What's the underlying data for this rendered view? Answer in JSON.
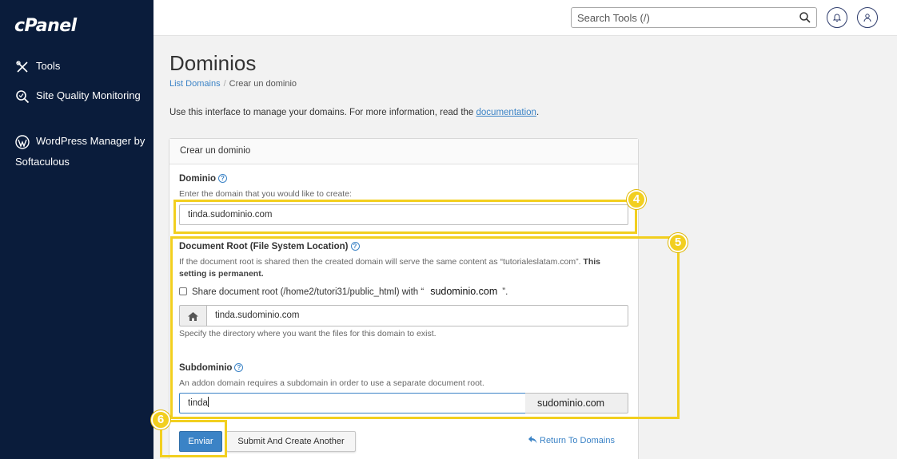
{
  "sidebar": {
    "logo": "cPanel",
    "items": [
      {
        "label": "Tools",
        "icon": "tools-icon"
      },
      {
        "label": "Site Quality Monitoring",
        "icon": "search-quality-icon"
      },
      {
        "label": "WordPress Manager by Softaculous",
        "icon": "wordpress-icon"
      }
    ]
  },
  "topbar": {
    "search_placeholder": "Search Tools (/)"
  },
  "page": {
    "title": "Dominios",
    "breadcrumb_link": "List Domains",
    "breadcrumb_current": "Crear un dominio",
    "intro_text": "Use this interface to manage your domains. For more information, read the ",
    "intro_link": "documentation",
    "intro_end": "."
  },
  "form": {
    "panel_title": "Crear un dominio",
    "domain_label": "Dominio",
    "domain_hint": "Enter the domain that you would like to create:",
    "domain_value": "tinda.sudominio.com",
    "docroot_label": "Document Root (File System Location)",
    "docroot_hint": "If the document root is shared then the created domain will serve the same content as “tutorialeslatam.com”.",
    "docroot_hint_bold": "This setting is permanent.",
    "share_text_before": "Share document root (/home2/tutori31/public_html) with “",
    "share_domain": "sudominio.com",
    "share_text_after": "”.",
    "docroot_value": "tinda.sudominio.com",
    "docroot_help": "Specify the directory where you want the files for this domain to exist.",
    "subdomain_label": "Subdominio",
    "subdomain_hint": "An addon domain requires a subdomain in order to use a separate document root.",
    "subdomain_value": "tinda",
    "subdomain_suffix": "sudominio.com",
    "submit_label": "Enviar",
    "submit_another_label": "Submit And Create Another",
    "return_label": "Return To Domains"
  },
  "annotations": {
    "badge_4": "4",
    "badge_5": "5",
    "badge_6": "6",
    "color": "#f2cf1f"
  }
}
